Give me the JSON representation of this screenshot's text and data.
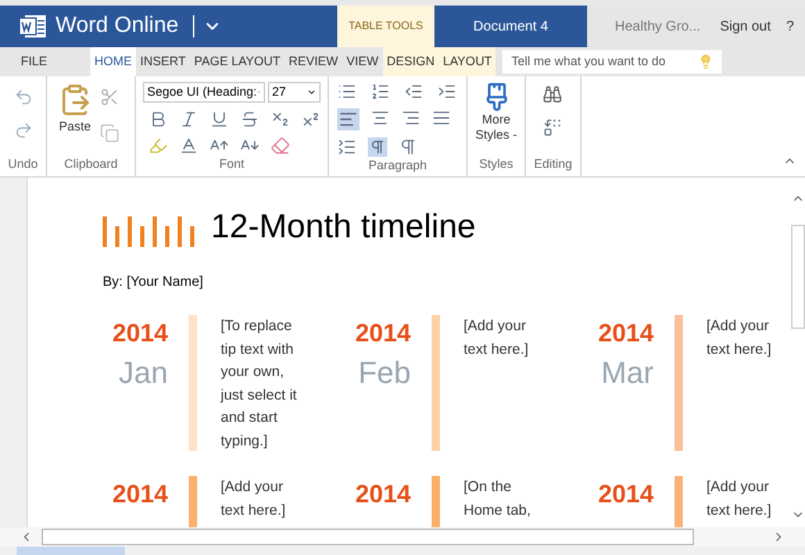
{
  "titlebar": {
    "app": "Word Online",
    "context_tab": "TABLE TOOLS",
    "document": "Document 4",
    "user": "Healthy Gro...",
    "sign_out": "Sign out",
    "help": "?"
  },
  "ribbon_tabs": [
    {
      "label": "FILE",
      "selected": false,
      "context": false
    },
    {
      "label": "HOME",
      "selected": true,
      "context": false
    },
    {
      "label": "INSERT",
      "selected": false,
      "context": false
    },
    {
      "label": "PAGE LAYOUT",
      "selected": false,
      "context": false
    },
    {
      "label": "REVIEW",
      "selected": false,
      "context": false
    },
    {
      "label": "VIEW",
      "selected": false,
      "context": false
    },
    {
      "label": "DESIGN",
      "selected": false,
      "context": true
    },
    {
      "label": "LAYOUT",
      "selected": false,
      "context": true
    }
  ],
  "search": {
    "placeholder": "Tell me what you want to do"
  },
  "ribbon": {
    "paste": "Paste",
    "font_name": "Segoe UI (Heading:",
    "font_size": "27",
    "more_styles": "More Styles -",
    "groups": [
      "Undo",
      "Clipboard",
      "Font",
      "Paragraph",
      "Styles",
      "Editing"
    ]
  },
  "document": {
    "title": "12-Month timeline",
    "byline": "By: [Your Name]",
    "rows": [
      [
        {
          "year": "2014",
          "month": "Jan",
          "text": "[To replace tip text with your own, just select it and start typing.]",
          "color": "#fde1c8"
        },
        {
          "year": "2014",
          "month": "Feb",
          "text": "[Add your text here.]",
          "color": "#fdd0a6"
        },
        {
          "year": "2014",
          "month": "Mar",
          "text": "[Add your text here.]",
          "color": "#fbc09a"
        }
      ],
      [
        {
          "year": "2014",
          "text": "[Add your text here.]",
          "color": "#fbb06e"
        },
        {
          "year": "2014",
          "text": "[On the Home tab,",
          "color": "#fbae68"
        },
        {
          "year": "2014",
          "text": "[Add your text here.]",
          "color": "#fbb27a"
        }
      ]
    ]
  }
}
